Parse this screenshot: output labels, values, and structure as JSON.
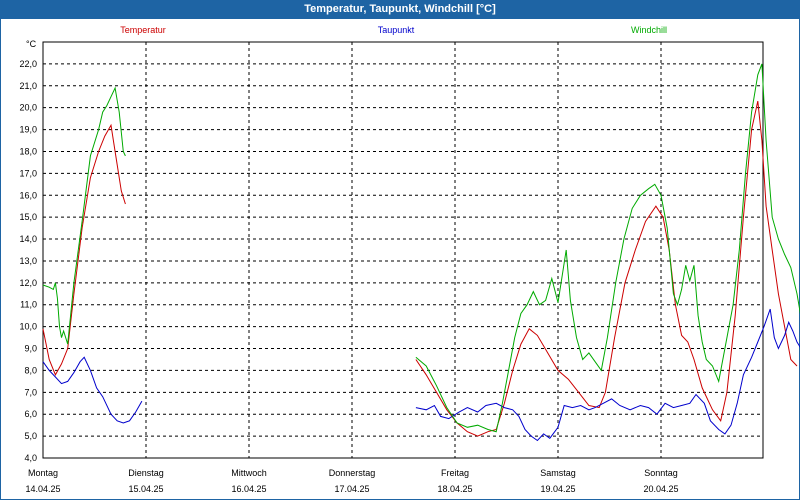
{
  "window": {
    "title": "Temperatur, Taupunkt, Windchill [°C]"
  },
  "chart_data": {
    "type": "line",
    "title": "Temperatur, Taupunkt, Windchill [°C]",
    "ylabel": "°C",
    "ylim": [
      4.0,
      23.0
    ],
    "yticks": [
      4.0,
      5.0,
      6.0,
      7.0,
      8.0,
      9.0,
      10.0,
      11.0,
      12.0,
      13.0,
      14.0,
      15.0,
      16.0,
      17.0,
      18.0,
      19.0,
      20.0,
      21.0,
      22.0
    ],
    "ytick_labels": [
      "4,0",
      "5,0",
      "6,0",
      "7,0",
      "8,0",
      "9,0",
      "10,0",
      "11,0",
      "12,0",
      "13,0",
      "14,0",
      "15,0",
      "16,0",
      "17,0",
      "18,0",
      "19,0",
      "20,0",
      "21,0",
      "22,0"
    ],
    "xlim": [
      0,
      7
    ],
    "x_unit": "days since Montag 14.04.25 00:00",
    "days": [
      {
        "name": "Montag",
        "date": "14.04.25"
      },
      {
        "name": "Dienstag",
        "date": "15.04.25"
      },
      {
        "name": "Mittwoch",
        "date": "16.04.25"
      },
      {
        "name": "Donnerstag",
        "date": "17.04.25"
      },
      {
        "name": "Freitag",
        "date": "18.04.25"
      },
      {
        "name": "Samstag",
        "date": "19.04.25"
      },
      {
        "name": "Sonntag",
        "date": "20.04.25"
      }
    ],
    "grid": true,
    "legend_position": "top",
    "series": [
      {
        "name": "Temperatur",
        "color": "#cc0000",
        "segments": [
          [
            [
              0.0,
              9.9
            ],
            [
              0.06,
              8.5
            ],
            [
              0.12,
              7.8
            ],
            [
              0.18,
              8.3
            ],
            [
              0.24,
              9.0
            ],
            [
              0.3,
              11.5
            ],
            [
              0.38,
              14.5
            ],
            [
              0.46,
              16.8
            ],
            [
              0.54,
              18.0
            ],
            [
              0.6,
              18.7
            ],
            [
              0.66,
              19.2
            ],
            [
              0.7,
              18.0
            ],
            [
              0.76,
              16.2
            ],
            [
              0.8,
              15.6
            ]
          ],
          [
            [
              3.62,
              8.5
            ],
            [
              3.72,
              7.8
            ],
            [
              3.82,
              7.0
            ],
            [
              3.92,
              6.2
            ],
            [
              4.02,
              5.6
            ],
            [
              4.12,
              5.2
            ],
            [
              4.22,
              5.0
            ],
            [
              4.32,
              5.2
            ],
            [
              4.4,
              5.3
            ],
            [
              4.48,
              6.5
            ],
            [
              4.56,
              8.0
            ],
            [
              4.64,
              9.2
            ],
            [
              4.72,
              9.9
            ],
            [
              4.8,
              9.6
            ],
            [
              4.9,
              8.8
            ],
            [
              5.0,
              8.0
            ],
            [
              5.1,
              7.6
            ],
            [
              5.2,
              7.0
            ],
            [
              5.3,
              6.4
            ],
            [
              5.4,
              6.3
            ],
            [
              5.46,
              7.0
            ],
            [
              5.55,
              9.5
            ],
            [
              5.65,
              12.0
            ],
            [
              5.75,
              13.5
            ],
            [
              5.85,
              14.8
            ],
            [
              5.95,
              15.5
            ],
            [
              6.02,
              15.0
            ],
            [
              6.08,
              13.5
            ],
            [
              6.14,
              11.0
            ],
            [
              6.2,
              9.6
            ],
            [
              6.26,
              9.3
            ],
            [
              6.32,
              8.5
            ],
            [
              6.4,
              7.2
            ],
            [
              6.5,
              6.2
            ],
            [
              6.58,
              5.7
            ],
            [
              6.64,
              7.0
            ],
            [
              6.72,
              10.5
            ],
            [
              6.8,
              15.0
            ],
            [
              6.88,
              19.0
            ],
            [
              6.94,
              20.3
            ],
            [
              6.98,
              18.5
            ],
            [
              7.02,
              15.5
            ],
            [
              7.08,
              13.5
            ],
            [
              7.14,
              11.5
            ],
            [
              7.2,
              10.0
            ],
            [
              7.26,
              8.5
            ],
            [
              7.32,
              8.2
            ]
          ]
        ]
      },
      {
        "name": "Taupunkt",
        "color": "#0000cc",
        "segments": [
          [
            [
              0.0,
              8.4
            ],
            [
              0.06,
              8.0
            ],
            [
              0.12,
              7.7
            ],
            [
              0.18,
              7.4
            ],
            [
              0.24,
              7.5
            ],
            [
              0.3,
              7.9
            ],
            [
              0.36,
              8.4
            ],
            [
              0.4,
              8.6
            ],
            [
              0.46,
              8.0
            ],
            [
              0.52,
              7.2
            ],
            [
              0.58,
              6.8
            ],
            [
              0.66,
              6.0
            ],
            [
              0.72,
              5.7
            ],
            [
              0.78,
              5.6
            ],
            [
              0.84,
              5.7
            ],
            [
              0.9,
              6.1
            ],
            [
              0.96,
              6.6
            ]
          ],
          [
            [
              3.62,
              6.3
            ],
            [
              3.72,
              6.2
            ],
            [
              3.8,
              6.4
            ],
            [
              3.86,
              5.9
            ],
            [
              3.94,
              5.8
            ],
            [
              4.04,
              6.1
            ],
            [
              4.12,
              6.3
            ],
            [
              4.22,
              6.1
            ],
            [
              4.3,
              6.4
            ],
            [
              4.4,
              6.5
            ],
            [
              4.48,
              6.3
            ],
            [
              4.56,
              6.2
            ],
            [
              4.62,
              5.9
            ],
            [
              4.68,
              5.3
            ],
            [
              4.74,
              5.0
            ],
            [
              4.8,
              4.8
            ],
            [
              4.86,
              5.1
            ],
            [
              4.92,
              4.9
            ],
            [
              5.0,
              5.4
            ],
            [
              5.06,
              6.4
            ],
            [
              5.14,
              6.3
            ],
            [
              5.22,
              6.4
            ],
            [
              5.3,
              6.2
            ],
            [
              5.36,
              6.3
            ],
            [
              5.44,
              6.5
            ],
            [
              5.52,
              6.7
            ],
            [
              5.6,
              6.4
            ],
            [
              5.7,
              6.2
            ],
            [
              5.8,
              6.4
            ],
            [
              5.88,
              6.3
            ],
            [
              5.96,
              6.0
            ],
            [
              6.04,
              6.5
            ],
            [
              6.12,
              6.3
            ],
            [
              6.2,
              6.4
            ],
            [
              6.28,
              6.5
            ],
            [
              6.34,
              6.9
            ],
            [
              6.42,
              6.5
            ],
            [
              6.48,
              5.7
            ],
            [
              6.56,
              5.3
            ],
            [
              6.62,
              5.1
            ],
            [
              6.68,
              5.5
            ],
            [
              6.74,
              6.5
            ],
            [
              6.8,
              7.8
            ],
            [
              6.88,
              8.6
            ],
            [
              6.94,
              9.3
            ],
            [
              7.0,
              10.0
            ],
            [
              7.06,
              10.8
            ],
            [
              7.1,
              9.5
            ],
            [
              7.14,
              9.0
            ],
            [
              7.2,
              9.6
            ],
            [
              7.24,
              10.2
            ],
            [
              7.28,
              9.8
            ],
            [
              7.32,
              9.3
            ],
            [
              7.36,
              9.0
            ],
            [
              7.4,
              9.1
            ]
          ]
        ]
      },
      {
        "name": "Windchill",
        "color": "#00aa00",
        "segments": [
          [
            [
              0.0,
              11.9
            ],
            [
              0.06,
              11.8
            ],
            [
              0.1,
              11.7
            ],
            [
              0.12,
              12.0
            ],
            [
              0.14,
              11.3
            ],
            [
              0.16,
              10.0
            ],
            [
              0.18,
              9.5
            ],
            [
              0.2,
              9.8
            ],
            [
              0.24,
              9.2
            ],
            [
              0.3,
              12.0
            ],
            [
              0.38,
              14.8
            ],
            [
              0.46,
              17.8
            ],
            [
              0.54,
              19.0
            ],
            [
              0.58,
              19.8
            ],
            [
              0.62,
              20.1
            ],
            [
              0.66,
              20.5
            ],
            [
              0.7,
              20.9
            ],
            [
              0.74,
              19.8
            ],
            [
              0.78,
              18.0
            ],
            [
              0.8,
              17.8
            ]
          ],
          [
            [
              3.62,
              8.6
            ],
            [
              3.72,
              8.2
            ],
            [
              3.82,
              7.3
            ],
            [
              3.92,
              6.3
            ],
            [
              4.02,
              5.6
            ],
            [
              4.12,
              5.4
            ],
            [
              4.22,
              5.5
            ],
            [
              4.32,
              5.3
            ],
            [
              4.4,
              5.2
            ],
            [
              4.46,
              6.5
            ],
            [
              4.52,
              8.0
            ],
            [
              4.58,
              9.5
            ],
            [
              4.64,
              10.6
            ],
            [
              4.7,
              11.0
            ],
            [
              4.76,
              11.6
            ],
            [
              4.82,
              11.0
            ],
            [
              4.88,
              11.2
            ],
            [
              4.94,
              12.2
            ],
            [
              5.0,
              11.1
            ],
            [
              5.04,
              12.3
            ],
            [
              5.08,
              13.5
            ],
            [
              5.12,
              11.2
            ],
            [
              5.18,
              9.5
            ],
            [
              5.24,
              8.5
            ],
            [
              5.3,
              8.8
            ],
            [
              5.36,
              8.4
            ],
            [
              5.42,
              8.0
            ],
            [
              5.48,
              9.5
            ],
            [
              5.56,
              12.0
            ],
            [
              5.64,
              14.0
            ],
            [
              5.72,
              15.4
            ],
            [
              5.8,
              16.0
            ],
            [
              5.88,
              16.3
            ],
            [
              5.94,
              16.5
            ],
            [
              6.0,
              16.0
            ],
            [
              6.06,
              14.5
            ],
            [
              6.12,
              11.5
            ],
            [
              6.16,
              11.0
            ],
            [
              6.2,
              11.7
            ],
            [
              6.24,
              12.8
            ],
            [
              6.28,
              12.1
            ],
            [
              6.32,
              12.8
            ],
            [
              6.36,
              10.5
            ],
            [
              6.4,
              9.3
            ],
            [
              6.44,
              8.5
            ],
            [
              6.5,
              8.2
            ],
            [
              6.56,
              7.5
            ],
            [
              6.62,
              9.0
            ],
            [
              6.7,
              11.0
            ],
            [
              6.76,
              13.5
            ],
            [
              6.82,
              17.0
            ],
            [
              6.88,
              19.8
            ],
            [
              6.94,
              21.5
            ],
            [
              6.98,
              22.0
            ],
            [
              7.02,
              18.5
            ],
            [
              7.08,
              15.0
            ],
            [
              7.14,
              14.0
            ],
            [
              7.2,
              13.3
            ],
            [
              7.26,
              12.7
            ],
            [
              7.32,
              11.5
            ],
            [
              7.36,
              10.4
            ],
            [
              7.42,
              13.3
            ]
          ]
        ]
      }
    ]
  }
}
